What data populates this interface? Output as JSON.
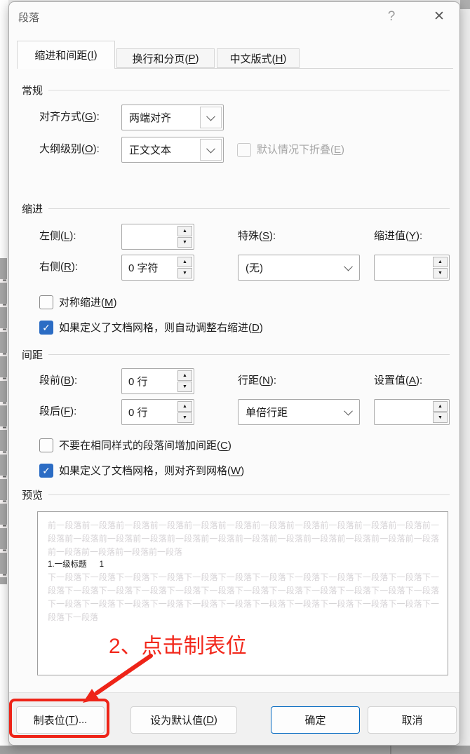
{
  "dialog": {
    "title": "段落"
  },
  "icons": {
    "help": "?",
    "close": "✕",
    "check": "✓",
    "spin_up": "▲",
    "spin_down": "▼"
  },
  "tabs": [
    {
      "label": "缩进和间距(I)",
      "active": true
    },
    {
      "label": "换行和分页(P)",
      "active": false
    },
    {
      "label": "中文版式(H)",
      "active": false
    }
  ],
  "general": {
    "section_title": "常规",
    "alignment_label": "对齐方式(G):",
    "alignment_value": "两端对齐",
    "outline_label": "大纲级别(O):",
    "outline_value": "正文文本",
    "collapsed_checkbox_label": "默认情况下折叠(E)"
  },
  "indent": {
    "section_title": "缩进",
    "left_label": "左侧(L):",
    "left_value": "",
    "right_label": "右侧(R):",
    "right_value": "0 字符",
    "special_label": "特殊(S):",
    "special_value": "(无)",
    "by_label": "缩进值(Y):",
    "by_value": "",
    "mirror_label": "对称缩进(M)",
    "auto_adjust_label": "如果定义了文档网格，则自动调整右缩进(D)"
  },
  "spacing": {
    "section_title": "间距",
    "before_label": "段前(B):",
    "before_value": "0 行",
    "after_label": "段后(F):",
    "after_value": "0 行",
    "line_spacing_label": "行距(N):",
    "line_spacing_value": "单倍行距",
    "at_label": "设置值(A):",
    "at_value": "",
    "no_space_label": "不要在相同样式的段落间增加间距(C)",
    "snap_grid_label": "如果定义了文档网格，则对齐到网格(W)"
  },
  "preview": {
    "section_title": "预览",
    "before_text": "前一段落前一段落前一段落前一段落前一段落前一段落前一段落前一段落前一段落前一段落前一段落前一段落前一段落前一段落前一段落前一段落前一段落前一段落前一段落前一段落前一段落前一段落前一段落前一段落前一段落前一段落前一段落",
    "heading_text": "1.一级标题",
    "heading_number": "1",
    "after_text": "下一段落下一段落下一段落下一段落下一段落下一段落下一段落下一段落下一段落下一段落下一段落下一段落下一段落下一段落下一段落下一段落下一段落下一段落下一段落下一段落下一段落下一段落下一段落下一段落下一段落下一段落下一段落下一段落下一段落下一段落下一段落下一段落下一段落下一段落下一段落下一段落"
  },
  "annotation": {
    "step_text": "2、点击制表位",
    "color": "#ee2418"
  },
  "footer": {
    "tabs_button": "制表位(T)...",
    "default_button": "设为默认值(D)",
    "ok_button": "确定",
    "cancel_button": "取消"
  }
}
